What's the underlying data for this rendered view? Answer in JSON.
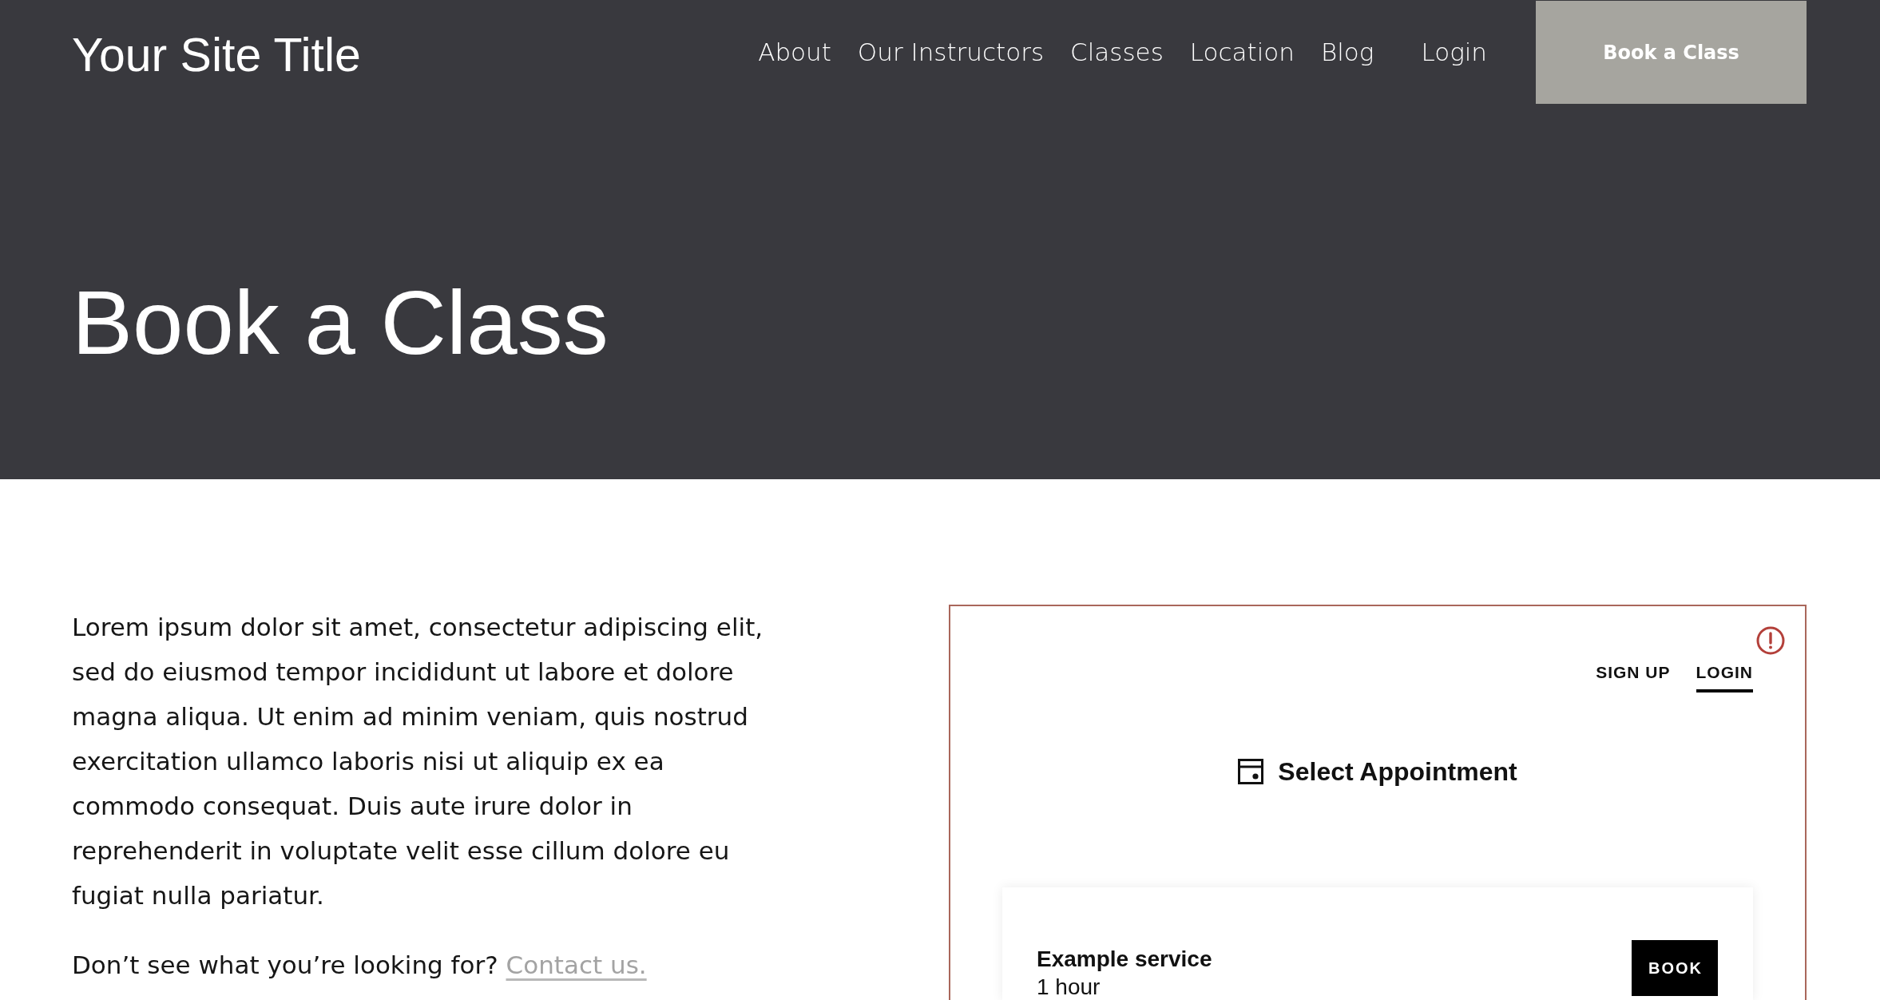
{
  "header": {
    "site_title": "Your Site Title",
    "nav": [
      "About",
      "Our Instructors",
      "Classes",
      "Location",
      "Blog"
    ],
    "login": "Login",
    "cta": "Book a Class"
  },
  "hero": {
    "title": "Book a Class"
  },
  "intro": {
    "paragraph": "Lorem ipsum dolor sit amet, consectetur adipiscing elit, sed do eiusmod tempor incididunt ut labore et dolore magna aliqua. Ut enim ad minim veniam, quis nostrud exercitation ullamco laboris nisi ut aliquip ex ea commodo consequat. Duis aute irure dolor in reprehenderit in voluptate velit esse cillum dolore eu fugiat nulla pariatur.",
    "prompt": "Don’t see what you’re looking for?",
    "link": "Contact us."
  },
  "scheduler": {
    "tabs": [
      {
        "label": "SIGN UP",
        "selected": false
      },
      {
        "label": "LOGIN",
        "selected": true
      }
    ],
    "heading": "Select Appointment",
    "services": [
      {
        "name": "Example service",
        "duration": "1 hour",
        "button": "BOOK"
      }
    ]
  }
}
